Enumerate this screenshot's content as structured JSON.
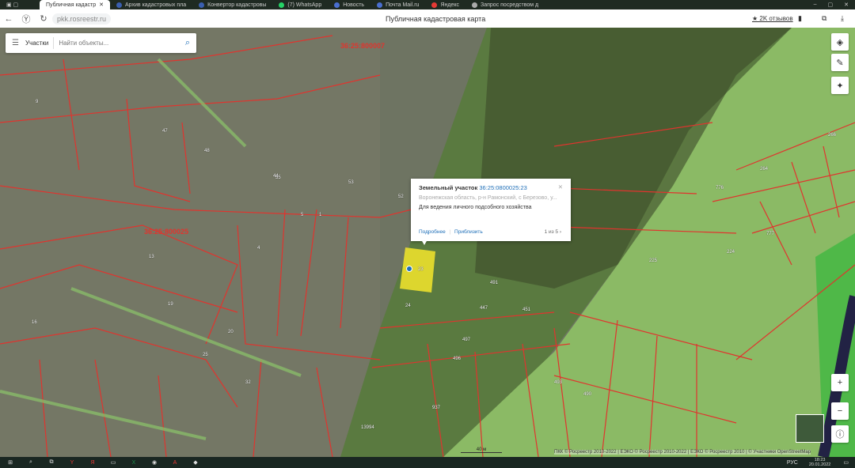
{
  "tabs": [
    {
      "label": "Публичная кадастр",
      "active": true
    },
    {
      "label": "Архив кадастровых пла"
    },
    {
      "label": "Конвертор кадастровы"
    },
    {
      "label": "(7) WhatsApp"
    },
    {
      "label": "Новость"
    },
    {
      "label": "Почта Mail.ru"
    },
    {
      "label": "Яндекс"
    },
    {
      "label": "Запрос посредством д"
    }
  ],
  "address": {
    "url": "pkk.rosreestr.ru",
    "page_title": "Публичная кадастровая карта",
    "reviews": "★ 2K отзывов"
  },
  "search": {
    "filter": "Участки",
    "placeholder": "Найти объекты..."
  },
  "popup": {
    "title": "Земельный участок",
    "cad_number": "36:25:0800025:23",
    "address": "Воронежская область, р-н Рамонский, с Березово, у...",
    "purpose": "Для ведения личного подсобного хозяйства",
    "more": "Подробнее",
    "zoom_to": "Приблизить",
    "pager": "1 из 5"
  },
  "map": {
    "quarters": [
      "36:25:800007",
      "36:25:800025"
    ],
    "labels": [
      "9",
      "47",
      "48",
      "44",
      "53",
      "52",
      "5",
      "4",
      "1",
      "24",
      "23",
      "447",
      "451",
      "491",
      "490",
      "493",
      "496",
      "497",
      "225",
      "224",
      "264",
      "266",
      "776",
      "777",
      "13",
      "16",
      "19",
      "20",
      "25",
      "32",
      "937",
      "13994",
      "55"
    ],
    "scale": "40 м",
    "attribution": "ПКК © Росреестр 2010-2022 | ЕЭКО © Росреестр 2010-2022 | ЕЭКО © Росреестр 2010 | © Участники OpenStreetMap"
  },
  "taskbar": {
    "lang": "РУС",
    "time": "18:23",
    "date": "20.01.2022"
  },
  "colors": {
    "parcel": "#e0342e",
    "accent": "#1f6fb8",
    "highlight": "#f5e62b"
  }
}
